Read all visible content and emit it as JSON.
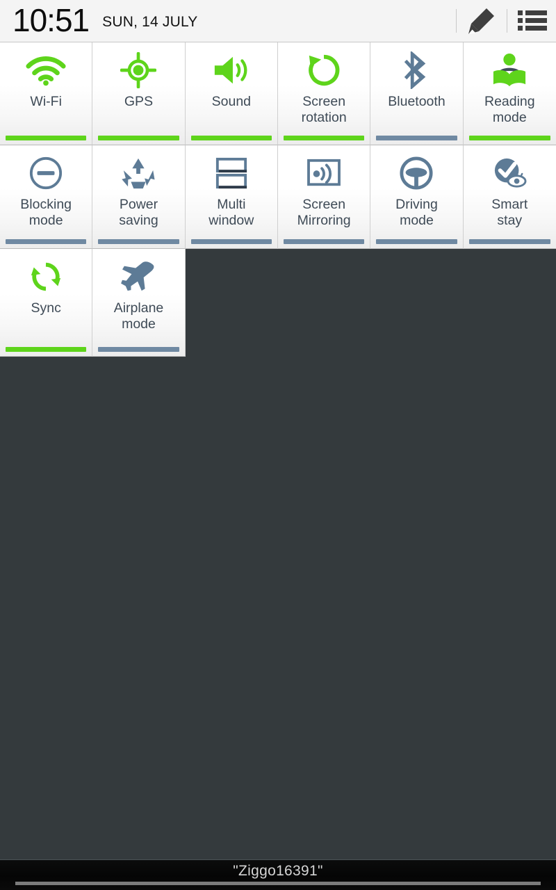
{
  "statusbar": {
    "time": "10:51",
    "date": "SUN, 14 JULY",
    "edit_icon": "pencil-icon",
    "list_icon": "list-icon"
  },
  "colors": {
    "active": "#5ed41b",
    "inactive": "#6f89a2",
    "background": "#343a3d",
    "tile_bg": "#ffffff",
    "label_text": "#3e4a56"
  },
  "tiles": [
    {
      "label_line1": "Wi-Fi",
      "label_line2": "",
      "icon": "wifi-icon",
      "state": "on"
    },
    {
      "label_line1": "GPS",
      "label_line2": "",
      "icon": "gps-icon",
      "state": "on"
    },
    {
      "label_line1": "Sound",
      "label_line2": "",
      "icon": "sound-icon",
      "state": "on"
    },
    {
      "label_line1": "Screen",
      "label_line2": "rotation",
      "icon": "screen-rotation-icon",
      "state": "on"
    },
    {
      "label_line1": "Bluetooth",
      "label_line2": "",
      "icon": "bluetooth-icon",
      "state": "off"
    },
    {
      "label_line1": "Reading",
      "label_line2": "mode",
      "icon": "reading-mode-icon",
      "state": "on"
    },
    {
      "label_line1": "Blocking",
      "label_line2": "mode",
      "icon": "blocking-mode-icon",
      "state": "off"
    },
    {
      "label_line1": "Power",
      "label_line2": "saving",
      "icon": "power-saving-icon",
      "state": "off"
    },
    {
      "label_line1": "Multi",
      "label_line2": "window",
      "icon": "multi-window-icon",
      "state": "off"
    },
    {
      "label_line1": "Screen",
      "label_line2": "Mirroring",
      "icon": "screen-mirroring-icon",
      "state": "off"
    },
    {
      "label_line1": "Driving",
      "label_line2": "mode",
      "icon": "driving-mode-icon",
      "state": "off"
    },
    {
      "label_line1": "Smart",
      "label_line2": "stay",
      "icon": "smart-stay-icon",
      "state": "off"
    },
    {
      "label_line1": "Sync",
      "label_line2": "",
      "icon": "sync-icon",
      "state": "on"
    },
    {
      "label_line1": "Airplane",
      "label_line2": "mode",
      "icon": "airplane-mode-icon",
      "state": "off"
    }
  ],
  "bottom": {
    "ssid": "\"Ziggo16391\""
  }
}
